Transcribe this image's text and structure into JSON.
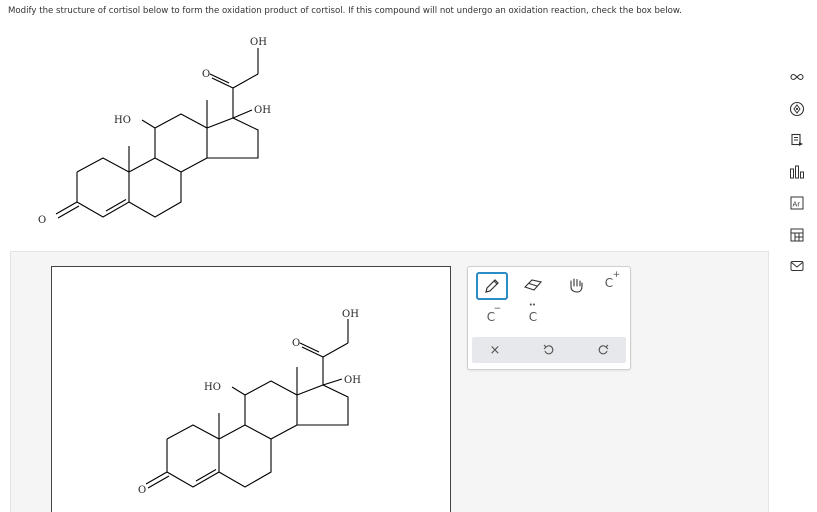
{
  "prompt": {
    "text": "Modify the structure of cortisol below to form the oxidation product of cortisol. If this compound will not undergo an oxidation reaction, check the box below."
  },
  "molecule": {
    "labels": {
      "oh_top": "OH",
      "oh_c17": "OH",
      "ho_c11": "HO",
      "o_c20": "O",
      "o_c3": "O"
    }
  },
  "toolbar": {
    "carbanion": "C",
    "carbanion_charge": "−",
    "carbene": "C",
    "carbene_dots": "••",
    "carbocation": "C",
    "carbocation_charge": "+",
    "delete_glyph": "×"
  },
  "side_tools": [
    {
      "icon": "infinity-icon"
    },
    {
      "icon": "target-icon"
    },
    {
      "icon": "copy-icon"
    },
    {
      "icon": "bar-chart-icon"
    },
    {
      "icon": "periodic-table-icon"
    },
    {
      "icon": "template-icon"
    },
    {
      "icon": "mail-icon"
    }
  ],
  "colors": {
    "accent": "#2a8bc7",
    "panel_bg": "#f5f5f5",
    "toolbar_row_bg": "#e6e8eb"
  }
}
